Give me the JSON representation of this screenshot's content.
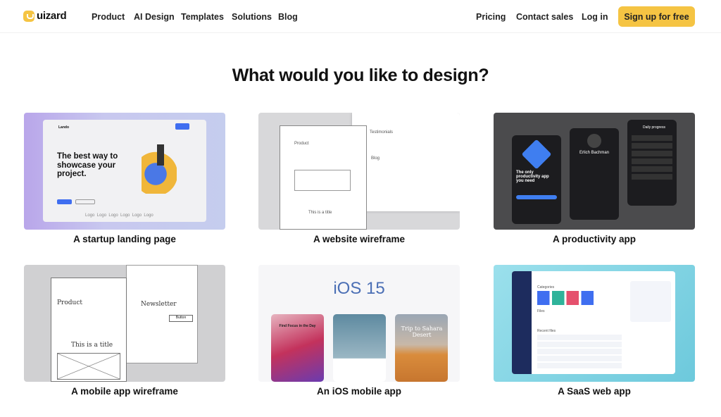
{
  "nav": {
    "brand": "uizard",
    "left": [
      "Product",
      "AI Design",
      "Templates",
      "Solutions",
      "Blog"
    ],
    "right": [
      "Pricing",
      "Contact sales",
      "Log in"
    ],
    "cta": "Sign up for free",
    "accent": "#f5c443"
  },
  "heading": "What would you like to design?",
  "cards": [
    {
      "label": "A startup landing page",
      "brand": "Lando",
      "headline": "The best way to showcase your project.",
      "logos": "Logo  Logo  Logo  Logo  Logo  Logo"
    },
    {
      "label": "A website wireframe",
      "title1": "Product",
      "title2": "Testimonials",
      "title3": "Blog",
      "footer": "This is a title"
    },
    {
      "label": "A productivity app",
      "text1": "The only productivity app you need",
      "name": "Erlich Bachman",
      "text3": "Daily progress"
    },
    {
      "label": "A mobile app wireframe",
      "title1": "Product",
      "title2": "Newsletter",
      "title3": "This is a title",
      "button": "Button"
    },
    {
      "label": "An iOS mobile app",
      "title": "iOS 15",
      "screen1": "Find Focus in the Day",
      "screen3": "Trip to Sahara Desert"
    },
    {
      "label": "A SaaS web app",
      "section1": "Categories",
      "section2": "Files",
      "section3": "Recent files"
    }
  ]
}
